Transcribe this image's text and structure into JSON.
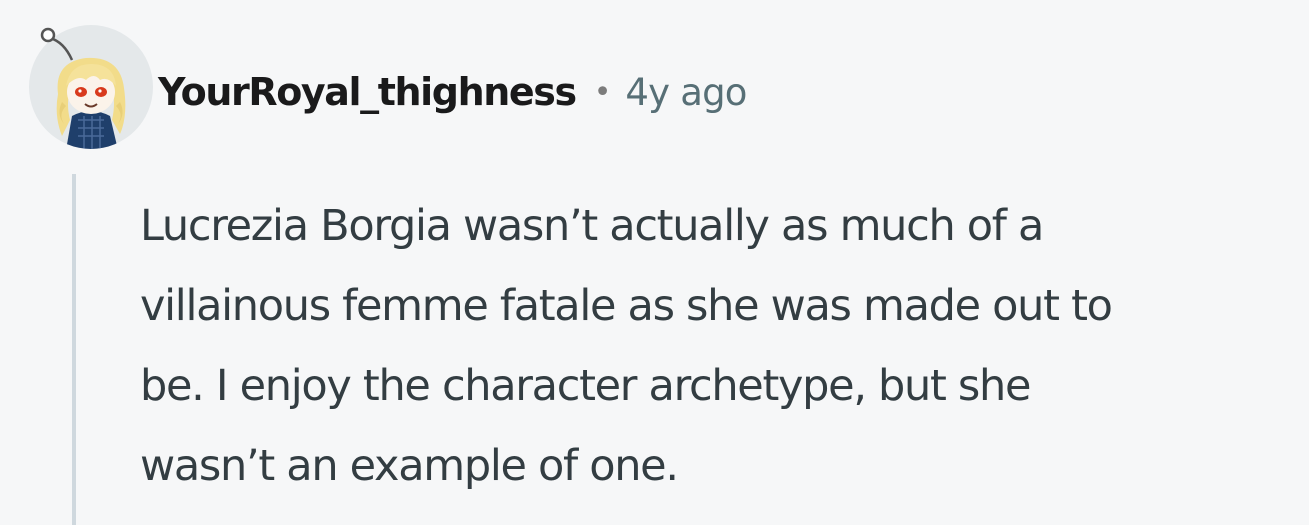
{
  "comment": {
    "author": "YourRoyal_thighness",
    "separator": "•",
    "timestamp": "4y ago",
    "body_lines": [
      "Lucrezia Borgia wasn’t actually as much of a",
      "villainous femme fatale as she was made out to",
      "be. I enjoy the character archetype, but she",
      "wasn’t an example of one."
    ]
  },
  "colors": {
    "background": "#f6f7f8",
    "username": "#1a1a1b",
    "timestamp": "#576f76",
    "body": "#333d42",
    "thread_line": "#cfd8de"
  },
  "icons": {
    "avatar": "snoo-avatar-icon"
  }
}
